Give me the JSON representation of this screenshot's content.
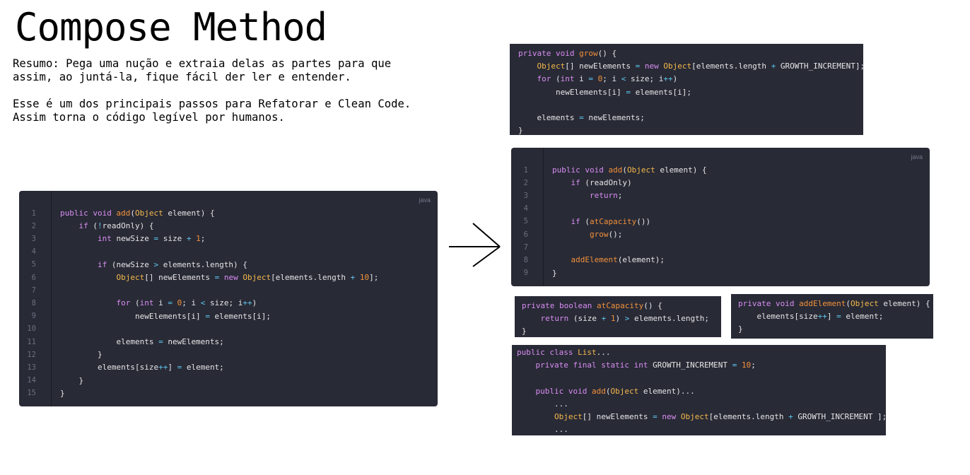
{
  "title": "Compose Method",
  "description": {
    "line1": "Resumo: Pega uma nução e extraia delas as partes para que",
    "line2": "assim, ao juntá-la, fique fácil der ler e entender.",
    "line3": "Esse é um dos principais passos para Refatorar e Clean Code.",
    "line4": "Assim torna o código legível por humanos."
  },
  "colors": {
    "background": "#ffffff",
    "code_background": "#282a36",
    "keyword": "#d98df2",
    "type": "#f5b94a",
    "function": "#f2913a",
    "number": "#f2913a",
    "operator": "#5ec8ef",
    "plain": "#e6e6e6"
  },
  "icons": {
    "arrow": "arrow-right-icon"
  },
  "blocks": [
    {
      "id": "original-add",
      "language": "java",
      "line_numbers": true,
      "lines": [
        [
          [
            "k",
            "public "
          ],
          [
            "k",
            "void "
          ],
          [
            "f",
            "add"
          ],
          [
            "p",
            "("
          ],
          [
            "t",
            "Object"
          ],
          [
            "p",
            " element) {"
          ]
        ],
        [
          [
            "p",
            "    "
          ],
          [
            "k",
            "if"
          ],
          [
            "p",
            " ("
          ],
          [
            "o",
            "!"
          ],
          [
            "p",
            "readOnly) {"
          ]
        ],
        [
          [
            "p",
            "        "
          ],
          [
            "k",
            "int"
          ],
          [
            "p",
            " newSize "
          ],
          [
            "o",
            "="
          ],
          [
            "p",
            " size "
          ],
          [
            "o",
            "+"
          ],
          [
            "p",
            " "
          ],
          [
            "n",
            "1"
          ],
          [
            "p",
            ";"
          ]
        ],
        [],
        [
          [
            "p",
            "        "
          ],
          [
            "k",
            "if"
          ],
          [
            "p",
            " (newSize "
          ],
          [
            "o",
            ">"
          ],
          [
            "p",
            " elements.length) {"
          ]
        ],
        [
          [
            "p",
            "            "
          ],
          [
            "t",
            "Object"
          ],
          [
            "p",
            "[] newElements "
          ],
          [
            "o",
            "="
          ],
          [
            "p",
            " "
          ],
          [
            "k",
            "new"
          ],
          [
            "p",
            " "
          ],
          [
            "t",
            "Object"
          ],
          [
            "p",
            "[elements.length "
          ],
          [
            "o",
            "+"
          ],
          [
            "p",
            " "
          ],
          [
            "n",
            "10"
          ],
          [
            "p",
            "];"
          ]
        ],
        [],
        [
          [
            "p",
            "            "
          ],
          [
            "k",
            "for"
          ],
          [
            "p",
            " ("
          ],
          [
            "k",
            "int"
          ],
          [
            "p",
            " i "
          ],
          [
            "o",
            "="
          ],
          [
            "p",
            " "
          ],
          [
            "n",
            "0"
          ],
          [
            "p",
            "; i "
          ],
          [
            "o",
            "<"
          ],
          [
            "p",
            " size; i"
          ],
          [
            "o",
            "++"
          ],
          [
            "p",
            ")"
          ]
        ],
        [
          [
            "p",
            "                newElements[i] "
          ],
          [
            "o",
            "="
          ],
          [
            "p",
            " elements[i];"
          ]
        ],
        [],
        [
          [
            "p",
            "            elements "
          ],
          [
            "o",
            "="
          ],
          [
            "p",
            " newElements;"
          ]
        ],
        [
          [
            "p",
            "        }"
          ]
        ],
        [
          [
            "p",
            "        elements[size"
          ],
          [
            "o",
            "++"
          ],
          [
            "p",
            "] "
          ],
          [
            "o",
            "="
          ],
          [
            "p",
            " element;"
          ]
        ],
        [
          [
            "p",
            "    }"
          ]
        ],
        [
          [
            "p",
            "}"
          ]
        ]
      ]
    },
    {
      "id": "grow",
      "language": "",
      "line_numbers": false,
      "lines": [
        [
          [
            "k",
            "private "
          ],
          [
            "k",
            "void "
          ],
          [
            "f",
            "grow"
          ],
          [
            "p",
            "() {"
          ]
        ],
        [
          [
            "p",
            "    "
          ],
          [
            "t",
            "Object"
          ],
          [
            "p",
            "[] newElements "
          ],
          [
            "o",
            "="
          ],
          [
            "p",
            " "
          ],
          [
            "k",
            "new"
          ],
          [
            "p",
            " "
          ],
          [
            "t",
            "Object"
          ],
          [
            "p",
            "[elements.length "
          ],
          [
            "o",
            "+"
          ],
          [
            "p",
            " GROWTH_INCREMENT];"
          ]
        ],
        [
          [
            "p",
            "    "
          ],
          [
            "k",
            "for"
          ],
          [
            "p",
            " ("
          ],
          [
            "k",
            "int"
          ],
          [
            "p",
            " i "
          ],
          [
            "o",
            "="
          ],
          [
            "p",
            " "
          ],
          [
            "n",
            "0"
          ],
          [
            "p",
            "; i "
          ],
          [
            "o",
            "<"
          ],
          [
            "p",
            " size; i"
          ],
          [
            "o",
            "++"
          ],
          [
            "p",
            ")"
          ]
        ],
        [
          [
            "p",
            "        newElements[i] "
          ],
          [
            "o",
            "="
          ],
          [
            "p",
            " elements[i];"
          ]
        ],
        [],
        [
          [
            "p",
            "    elements "
          ],
          [
            "o",
            "="
          ],
          [
            "p",
            " newElements;"
          ]
        ],
        [
          [
            "p",
            "}"
          ]
        ]
      ]
    },
    {
      "id": "refactored-add",
      "language": "java",
      "line_numbers": true,
      "lines": [
        [
          [
            "k",
            "public "
          ],
          [
            "k",
            "void "
          ],
          [
            "f",
            "add"
          ],
          [
            "p",
            "("
          ],
          [
            "t",
            "Object"
          ],
          [
            "p",
            " element) {"
          ]
        ],
        [
          [
            "p",
            "    "
          ],
          [
            "k",
            "if"
          ],
          [
            "p",
            " (readOnly)"
          ]
        ],
        [
          [
            "p",
            "        "
          ],
          [
            "k",
            "return"
          ],
          [
            "p",
            ";"
          ]
        ],
        [],
        [
          [
            "p",
            "    "
          ],
          [
            "k",
            "if"
          ],
          [
            "p",
            " ("
          ],
          [
            "f",
            "atCapacity"
          ],
          [
            "p",
            "())"
          ]
        ],
        [
          [
            "p",
            "        "
          ],
          [
            "f",
            "grow"
          ],
          [
            "p",
            "();"
          ]
        ],
        [],
        [
          [
            "p",
            "    "
          ],
          [
            "f",
            "addElement"
          ],
          [
            "p",
            "(element);"
          ]
        ],
        [
          [
            "p",
            "}"
          ]
        ]
      ]
    },
    {
      "id": "at-capacity",
      "language": "",
      "line_numbers": false,
      "lines": [
        [
          [
            "k",
            "private "
          ],
          [
            "k",
            "boolean "
          ],
          [
            "f",
            "atCapacity"
          ],
          [
            "p",
            "() {"
          ]
        ],
        [
          [
            "p",
            "    "
          ],
          [
            "k",
            "return"
          ],
          [
            "p",
            " (size "
          ],
          [
            "o",
            "+"
          ],
          [
            "p",
            " "
          ],
          [
            "n",
            "1"
          ],
          [
            "p",
            ") "
          ],
          [
            "o",
            ">"
          ],
          [
            "p",
            " elements.length;"
          ]
        ],
        [
          [
            "p",
            "}"
          ]
        ]
      ]
    },
    {
      "id": "add-element",
      "language": "",
      "line_numbers": false,
      "lines": [
        [
          [
            "k",
            "private "
          ],
          [
            "k",
            "void "
          ],
          [
            "f",
            "addElement"
          ],
          [
            "p",
            "("
          ],
          [
            "t",
            "Object"
          ],
          [
            "p",
            " element) {"
          ]
        ],
        [
          [
            "p",
            "    elements[size"
          ],
          [
            "o",
            "++"
          ],
          [
            "p",
            "] "
          ],
          [
            "o",
            "="
          ],
          [
            "p",
            " element;"
          ]
        ],
        [
          [
            "p",
            "}"
          ]
        ]
      ]
    },
    {
      "id": "class-list",
      "language": "",
      "line_numbers": false,
      "lines": [
        [
          [
            "k",
            "public "
          ],
          [
            "k",
            "class "
          ],
          [
            "t",
            "List"
          ],
          [
            "p",
            "..."
          ]
        ],
        [
          [
            "p",
            "    "
          ],
          [
            "k",
            "private "
          ],
          [
            "k",
            "final "
          ],
          [
            "k",
            "static "
          ],
          [
            "k",
            "int"
          ],
          [
            "p",
            " GROWTH_INCREMENT "
          ],
          [
            "o",
            "="
          ],
          [
            "p",
            " "
          ],
          [
            "n",
            "10"
          ],
          [
            "p",
            ";"
          ]
        ],
        [],
        [
          [
            "p",
            "    "
          ],
          [
            "k",
            "public "
          ],
          [
            "k",
            "void "
          ],
          [
            "f",
            "add"
          ],
          [
            "p",
            "("
          ],
          [
            "t",
            "Object"
          ],
          [
            "p",
            " element)..."
          ]
        ],
        [
          [
            "p",
            "        ..."
          ]
        ],
        [
          [
            "p",
            "        "
          ],
          [
            "t",
            "Object"
          ],
          [
            "p",
            "[] newElements "
          ],
          [
            "o",
            "="
          ],
          [
            "p",
            " "
          ],
          [
            "k",
            "new"
          ],
          [
            "p",
            " "
          ],
          [
            "t",
            "Object"
          ],
          [
            "p",
            "[elements.length "
          ],
          [
            "o",
            "+"
          ],
          [
            "p",
            " GROWTH_INCREMENT ];"
          ]
        ],
        [
          [
            "p",
            "        ..."
          ]
        ]
      ]
    }
  ]
}
